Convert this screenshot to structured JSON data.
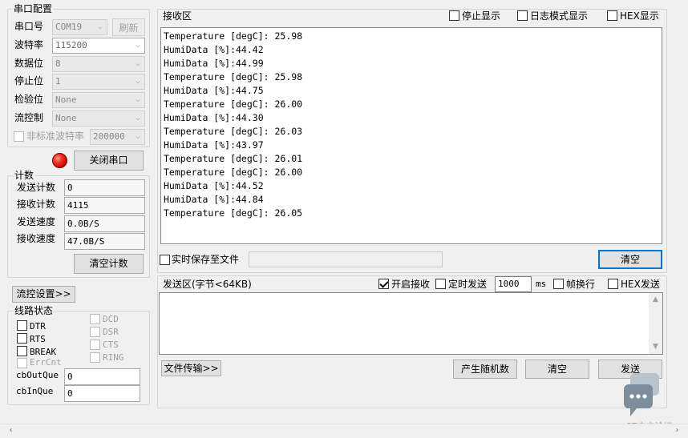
{
  "port_config": {
    "title": "串口配置",
    "port_label": "串口号",
    "port_value": "COM19",
    "refresh_label": "刷新",
    "baud_label": "波特率",
    "baud_value": "115200",
    "databits_label": "数据位",
    "databits_value": "8",
    "stopbits_label": "停止位",
    "stopbits_value": "1",
    "parity_label": "检验位",
    "parity_value": "None",
    "flow_label": "流控制",
    "flow_value": "None",
    "custom_baud_label": "非标准波特率",
    "custom_baud_value": "200000",
    "close_port_label": "关闭串口"
  },
  "counter": {
    "title": "计数",
    "send_count_label": "发送计数",
    "send_count_value": "0",
    "recv_count_label": "接收计数",
    "recv_count_value": "4115",
    "send_speed_label": "发送速度",
    "send_speed_value": "0.0B/S",
    "recv_speed_label": "接收速度",
    "recv_speed_value": "47.0B/S",
    "clear_label": "清空计数"
  },
  "flow_settings_label": "流控设置>>",
  "line_status": {
    "title": "线路状态",
    "dtr": "DTR",
    "rts": "RTS",
    "brk": "BREAK",
    "errcnt": "ErrCnt",
    "dcd": "DCD",
    "dsr": "DSR",
    "cts": "CTS",
    "ring": "RING",
    "cbout_label": "cbOutQue",
    "cbout_value": "0",
    "cbin_label": "cbInQue",
    "cbin_value": "0"
  },
  "receive": {
    "title": "接收区",
    "stop_display": "停止显示",
    "log_mode": "日志模式显示",
    "hex_display": "HEX显示",
    "lines": [
      "Temperature [degC]: 25.98",
      "HumiData [%]:44.42",
      "HumiData [%]:44.99",
      "Temperature [degC]: 25.98",
      "HumiData [%]:44.75",
      "Temperature [degC]: 26.00",
      "HumiData [%]:44.30",
      "Temperature [degC]: 26.03",
      "HumiData [%]:43.97",
      "Temperature [degC]: 26.01",
      "Temperature [degC]: 26.00",
      "HumiData [%]:44.52",
      "HumiData [%]:44.84",
      "Temperature [degC]: 26.05"
    ],
    "save_to_file": "实时保存至文件",
    "clear_label": "清空"
  },
  "send": {
    "title": "发送区(字节<64KB)",
    "enable_recv": "开启接收",
    "timed_send": "定时发送",
    "interval_value": "1000",
    "interval_unit": "ms",
    "frame_newline": "帧换行",
    "hex_send": "HEX发送",
    "file_transfer": "文件传输>>",
    "random_label": "产生随机数",
    "clear_label": "清空",
    "send_label": "发送"
  },
  "watermark": "ST中文论坛",
  "colors": {
    "led": "#e02010",
    "focus": "#0078d7"
  }
}
